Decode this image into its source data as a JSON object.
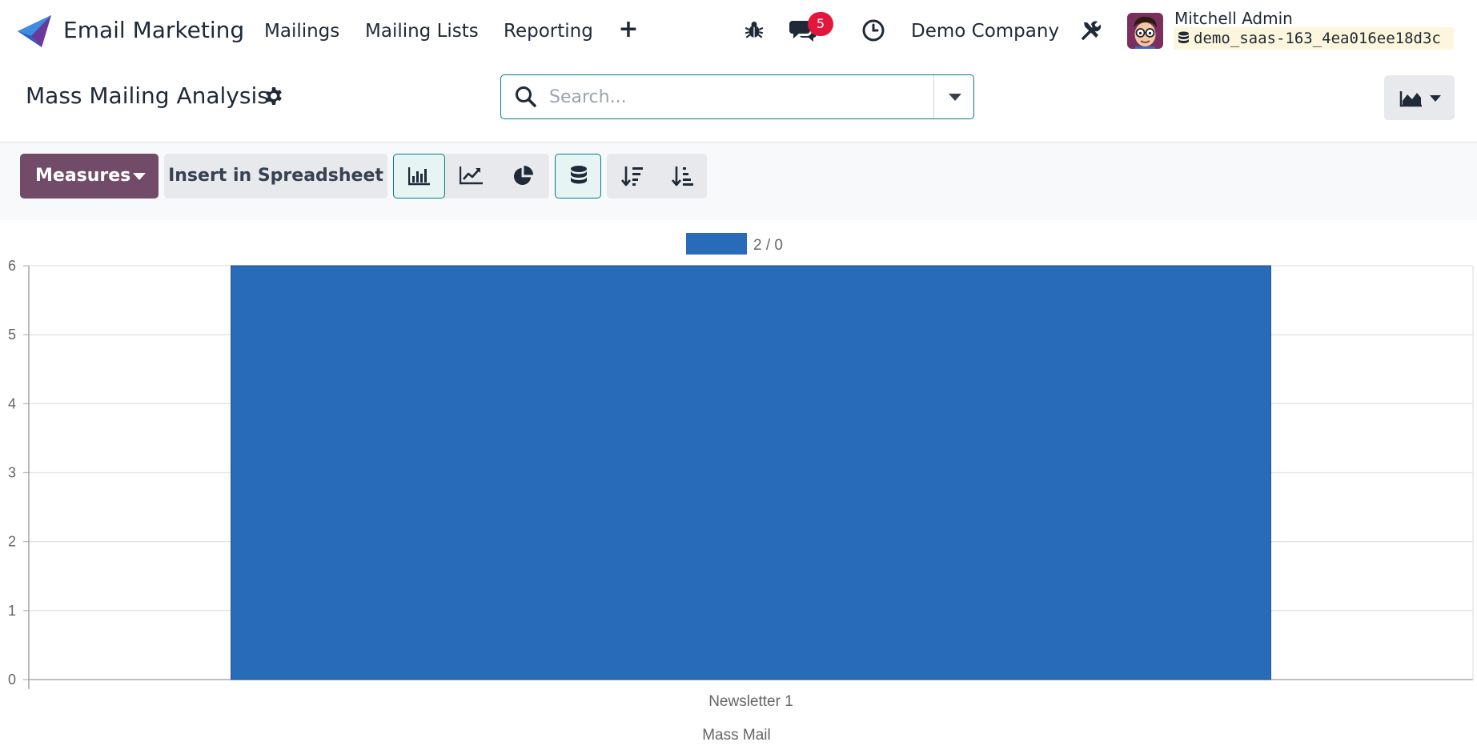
{
  "navbar": {
    "app_name": "Email Marketing",
    "menus": [
      {
        "label": "Mailings"
      },
      {
        "label": "Mailing Lists"
      },
      {
        "label": "Reporting"
      }
    ],
    "plus_icon": "plus-icon",
    "icons": [
      "bug-icon",
      "chat-bubbles-icon",
      "clock-icon",
      "tools-icon"
    ],
    "chat_count": "5",
    "company": "Demo Company",
    "user_name": "Mitchell Admin",
    "database": "demo_saas-163_4ea016ee18d3c",
    "accent_color": "#714b67",
    "badge_color": "#e3173e"
  },
  "control_panel": {
    "title": "Mass Mailing Analysis",
    "search_placeholder": "Search..."
  },
  "toolbar": {
    "measures_label": "Measures",
    "spreadsheet_label": "Insert in Spreadsheet",
    "chart_types": [
      "bar-chart-icon",
      "line-chart-icon",
      "pie-chart-icon"
    ],
    "active_chart_type": "bar",
    "stacked_icon": "database-stack-icon",
    "sort_icons": [
      "sort-descending-icon",
      "sort-ascending-icon"
    ]
  },
  "chart_data": {
    "type": "bar",
    "categories": [
      "Newsletter 1"
    ],
    "series": [
      {
        "name": "2 / 0",
        "values": [
          6
        ],
        "color": "#286bb8"
      }
    ],
    "xlabel": "Mass Mail",
    "ylabel": "",
    "ylim": [
      0,
      6
    ],
    "yticks": [
      "0",
      "1",
      "2",
      "3",
      "4",
      "5",
      "6"
    ],
    "grid": true,
    "legend": "top-center"
  }
}
